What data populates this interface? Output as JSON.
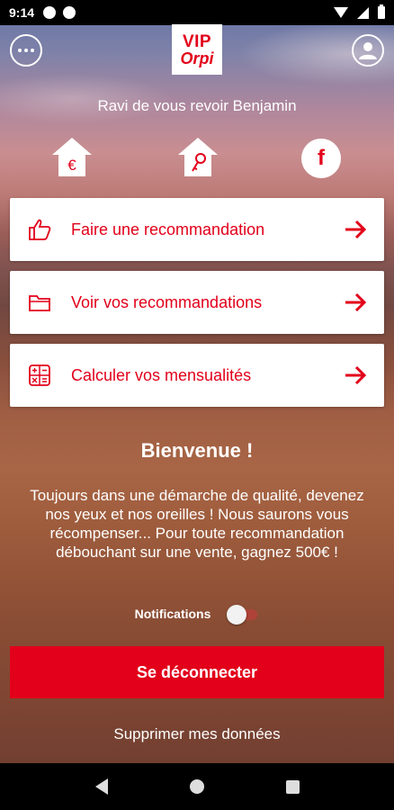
{
  "status_bar": {
    "time": "9:14"
  },
  "header": {
    "logo_line1": "VIP",
    "logo_line2": "Orpi"
  },
  "greeting": "Ravi de vous revoir Benjamin",
  "quick_icons": {
    "facebook_glyph": "f"
  },
  "actions": [
    {
      "label": "Faire une recommandation",
      "icon": "thumbs-up-icon"
    },
    {
      "label": "Voir vos recommandations",
      "icon": "folder-icon"
    },
    {
      "label": "Calculer vos mensualités",
      "icon": "calculator-icon"
    }
  ],
  "welcome": {
    "title": "Bienvenue !",
    "text": "Toujours dans une démarche de qualité, devenez nos yeux et nos oreilles ! Nous saurons vous récompenser... Pour toute recommandation débouchant sur une vente, gagnez 500€ !"
  },
  "notifications": {
    "label": "Notifications",
    "enabled": false
  },
  "logout_label": "Se déconnecter",
  "delete_label": "Supprimer mes données",
  "colors": {
    "brand_red": "#e2001a",
    "white": "#ffffff"
  }
}
